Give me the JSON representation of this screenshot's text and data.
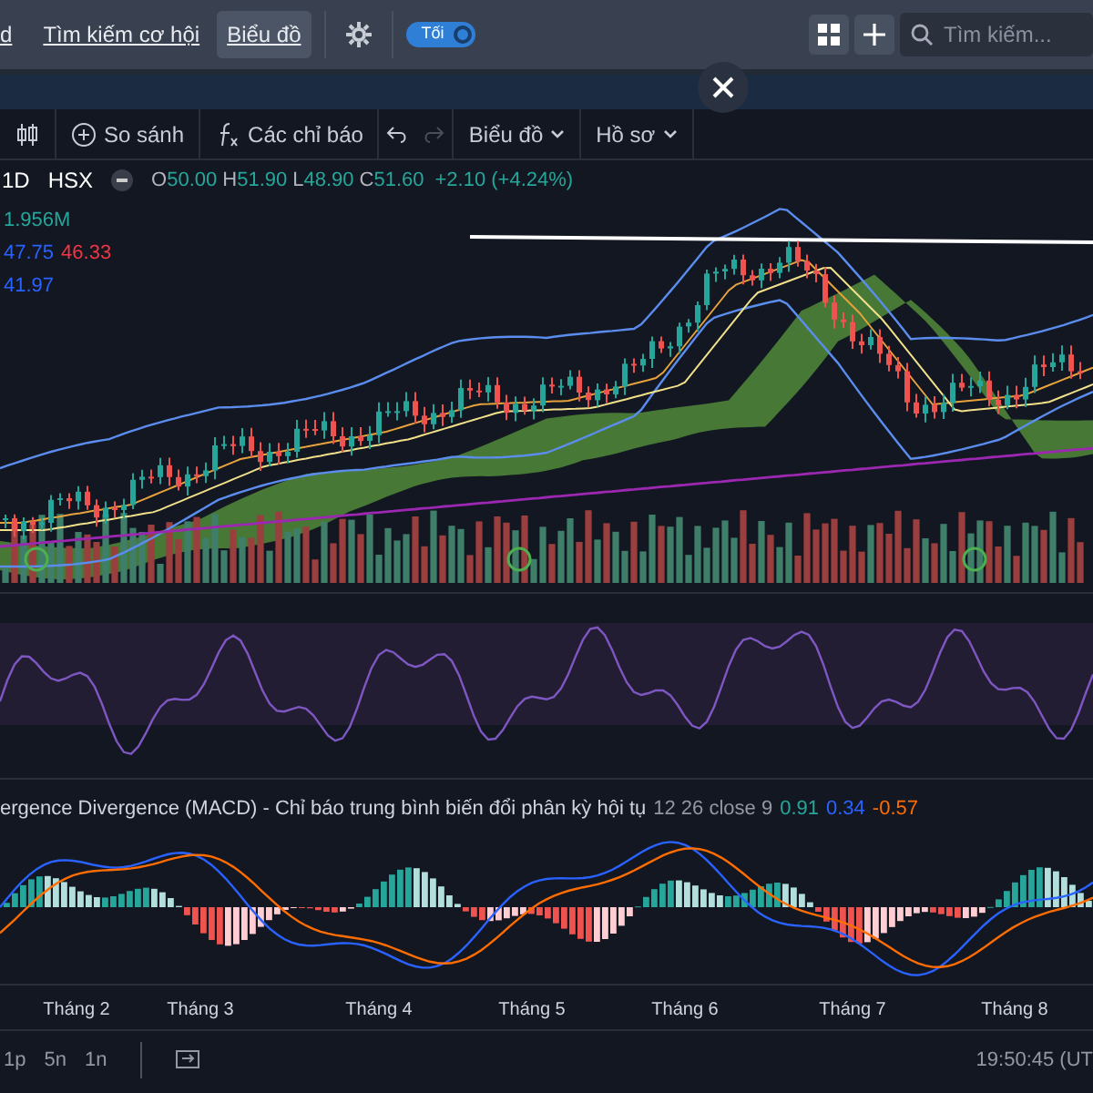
{
  "top_nav": {
    "items": [
      {
        "label": "d",
        "selected": false
      },
      {
        "label": "Tìm kiếm cơ hội",
        "selected": false
      },
      {
        "label": "Biểu đồ",
        "selected": true
      }
    ],
    "theme_toggle": {
      "label": "Tối",
      "on": true
    },
    "search": {
      "placeholder": "Tìm kiếm..."
    }
  },
  "toolbar": {
    "items": [
      {
        "kind": "icon",
        "disabled": false
      },
      {
        "kind": "button",
        "label": "So sánh",
        "disabled": false
      },
      {
        "kind": "button",
        "label": "Các chỉ báo",
        "disabled": false
      },
      {
        "kind": "undo",
        "disabled": false
      },
      {
        "kind": "redo",
        "disabled": true
      },
      {
        "kind": "dropdown",
        "label": "Biểu đồ",
        "disabled": false
      },
      {
        "kind": "dropdown",
        "label": "Hồ sơ",
        "disabled": false
      }
    ]
  },
  "legend": {
    "interval": "1D",
    "exchange": "HSX",
    "ohlc": [
      {
        "label": "O",
        "value": "50.00"
      },
      {
        "label": "H",
        "value": "51.90"
      },
      {
        "label": "L",
        "value": "48.90"
      },
      {
        "label": "C",
        "value": "51.60"
      }
    ],
    "change": "+2.10 (+4.24%)"
  },
  "indicator_values": [
    [
      {
        "text": "1.956M",
        "color": "#26a69a"
      }
    ],
    [
      {
        "text": "47.75",
        "color": "#2962ff"
      },
      {
        "text": "46.33",
        "color": "#f23645"
      }
    ],
    [
      {
        "text": "41.97",
        "color": "#2962ff"
      }
    ]
  ],
  "macd_legend": {
    "title": "ergence Divergence (MACD) - Chỉ báo trung bình biến đổi phân kỳ hội tụ",
    "params": "12 26 close 9",
    "values": [
      {
        "text": "0.91",
        "color": "#26a69a"
      },
      {
        "text": "0.34",
        "color": "#2962ff"
      },
      {
        "text": "-0.57",
        "color": "#ff6d00"
      }
    ]
  },
  "time_axis": [
    "Tháng 2",
    "Tháng 3",
    "Tháng 4",
    "Tháng 5",
    "Tháng 6",
    "Tháng 7",
    "Tháng 8"
  ],
  "bottom_bar": {
    "ranges": [
      "1p",
      "5n",
      "1n"
    ],
    "time": "19:50:45 (UT"
  }
}
